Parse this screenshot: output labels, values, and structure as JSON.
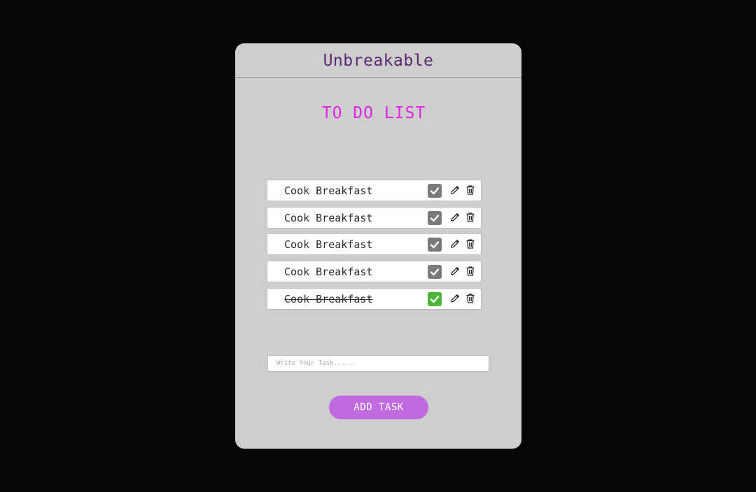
{
  "header": {
    "title": "Unbreakable"
  },
  "main": {
    "heading": "TO DO LIST",
    "tasks": [
      {
        "text": "Cook Breakfast",
        "completed": false
      },
      {
        "text": "Cook Breakfast",
        "completed": false
      },
      {
        "text": "Cook Breakfast",
        "completed": false
      },
      {
        "text": "Cook Breakfast",
        "completed": false
      },
      {
        "text": "Cook Breakfast",
        "completed": true
      }
    ],
    "task_actions": {
      "icons": [
        "check-icon",
        "pencil-icon",
        "trash-icon"
      ]
    },
    "input": {
      "placeholder": "Write Your Task......",
      "value": ""
    },
    "add_button": {
      "label": "ADD TASK"
    }
  },
  "colors": {
    "page_background": "#060606",
    "card_background": "#cecece",
    "title": "#5b2a75",
    "heading": "#e026e4",
    "checkbox_unchecked": "#7a7a7a",
    "checkbox_checked": "#4cb737",
    "button": "#bf6bdf"
  }
}
